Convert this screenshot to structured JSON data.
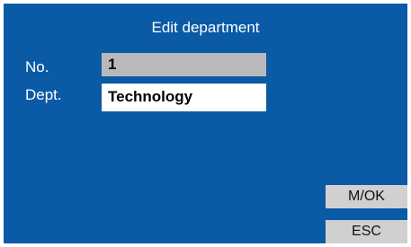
{
  "screen": {
    "title": "Edit department"
  },
  "form": {
    "no_label": "No.",
    "no_value": "1",
    "dept_label": "Dept.",
    "dept_value": "Technology"
  },
  "softkeys": {
    "ok_label": "M/OK",
    "esc_label": "ESC"
  },
  "colors": {
    "background": "#0b5aa6",
    "readonly_field": "#b9b9b9",
    "editable_field": "#ffffff",
    "softkey": "#d0d0d0"
  }
}
